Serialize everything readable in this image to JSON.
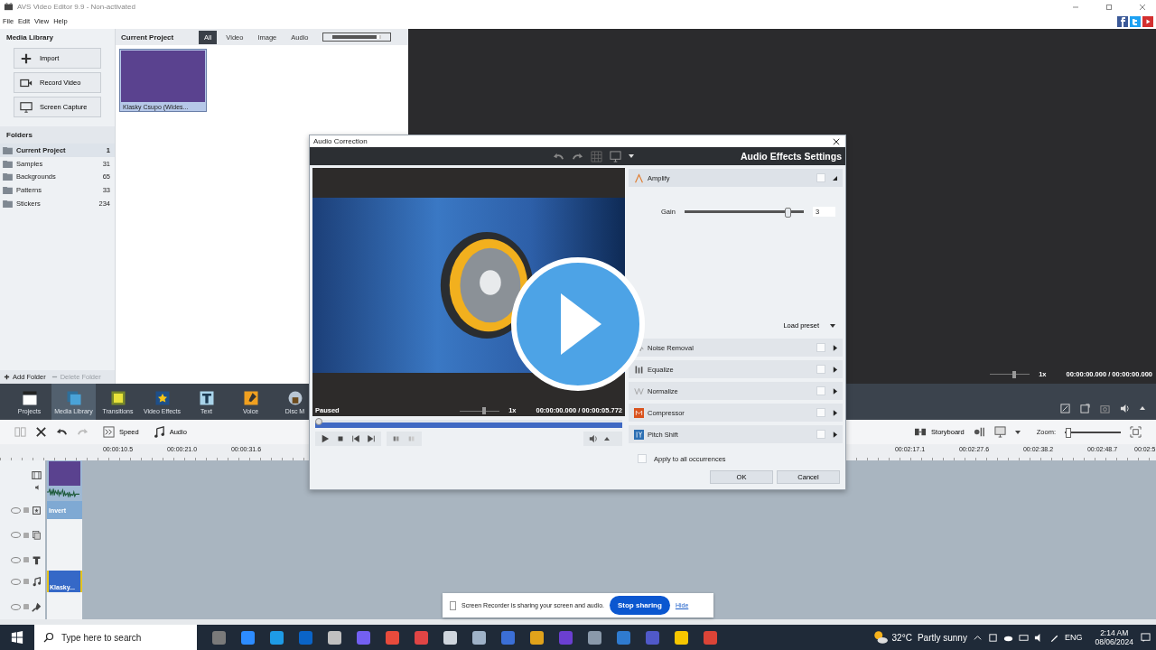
{
  "window": {
    "title": "AVS Video Editor 9.9 - Non-activated"
  },
  "menu": [
    "File",
    "Edit",
    "View",
    "Help"
  ],
  "media_library": {
    "title": "Media Library",
    "actions": [
      {
        "label": "Import",
        "kind": "import"
      },
      {
        "label": "Record Video",
        "kind": "record"
      },
      {
        "label": "Screen Capture",
        "kind": "capture"
      }
    ],
    "folders_title": "Folders",
    "folders": [
      {
        "name": "Current Project",
        "count": "1",
        "selected": true
      },
      {
        "name": "Samples",
        "count": "31",
        "selected": false
      },
      {
        "name": "Backgrounds",
        "count": "65",
        "selected": false
      },
      {
        "name": "Patterns",
        "count": "33",
        "selected": false
      },
      {
        "name": "Stickers",
        "count": "234",
        "selected": false
      }
    ],
    "add_folder": "Add Folder",
    "delete_folder": {
      "label": "Delete Folder",
      "disabled": true
    }
  },
  "project": {
    "title": "Current Project",
    "filters": [
      {
        "label": "All",
        "selected": true
      },
      {
        "label": "Video",
        "selected": false
      },
      {
        "label": "Image",
        "selected": false
      },
      {
        "label": "Audio",
        "selected": false
      }
    ],
    "size_slider": {
      "level": 0.95
    },
    "items": [
      {
        "name": "Klasky Csupo (Wides...",
        "selected": true
      }
    ]
  },
  "preview": {
    "speed_slider": {
      "level": 0.6
    },
    "speed": "1x",
    "time": "00:00:00.000 / 00:00:00.000"
  },
  "modes": [
    {
      "label": "Projects",
      "kind": "projects",
      "selected": false
    },
    {
      "label": "Media Library",
      "kind": "library",
      "selected": true
    },
    {
      "label": "Transitions",
      "kind": "transitions",
      "selected": false
    },
    {
      "label": "Video Effects",
      "kind": "effects",
      "selected": false
    },
    {
      "label": "Text",
      "kind": "text",
      "selected": false
    },
    {
      "label": "Voice",
      "kind": "voice",
      "selected": false
    },
    {
      "label": "Disc M",
      "kind": "disc",
      "selected": false
    }
  ],
  "timeline": {
    "tools": [
      {
        "label": "Speed",
        "kind": "speed"
      },
      {
        "label": "Audio",
        "kind": "audio"
      }
    ],
    "storyboard": "Storyboard",
    "zoom_label": "Zoom:",
    "zoom": {
      "level": 0.02
    },
    "ruler_left": [
      "00:00:10.5",
      "00:00:21.0",
      "00:00:31.6"
    ],
    "ruler_right": [
      "00:02:17.1",
      "00:02:27.6",
      "00:02:38.2",
      "00:02:48.7",
      "00:02:5"
    ],
    "effect_clip": "Invert",
    "audio_clip": "Klasky..."
  },
  "dialog": {
    "title": "Audio Correction",
    "heading": "Audio Effects Settings",
    "player": {
      "status": "Paused",
      "speed_slider": {
        "level": 0.6
      },
      "speed": "1x",
      "time": "00:00:00.000 / 00:00:05.772",
      "position": {
        "level": 0
      }
    },
    "effects": [
      {
        "name": "Amplify",
        "kind": "amplify",
        "expanded": true,
        "checked": false
      },
      {
        "name": "Noise Removal",
        "kind": "noise",
        "expanded": false,
        "checked": false
      },
      {
        "name": "Equalize",
        "kind": "equalize",
        "expanded": false,
        "checked": false
      },
      {
        "name": "Normalize",
        "kind": "normalize",
        "expanded": false,
        "checked": false
      },
      {
        "name": "Compressor",
        "kind": "compressor",
        "expanded": false,
        "checked": false
      },
      {
        "name": "Pitch Shift",
        "kind": "pitch",
        "expanded": false,
        "checked": false
      }
    ],
    "gain": {
      "label": "Gain",
      "level": 0.86,
      "value": "3"
    },
    "load_preset": "Load preset",
    "apply_all": {
      "label": "Apply to all occurrences",
      "checked": false
    },
    "buttons": [
      "OK",
      "Cancel"
    ]
  },
  "sharing": {
    "message": "Screen Recorder is sharing your screen and audio.",
    "stop": "Stop sharing",
    "hide": "Hide"
  },
  "taskbar": {
    "search_placeholder": "Type here to search",
    "temperature": "32°C",
    "weather": "Partly sunny",
    "language": "ENG",
    "time": "2:14 AM",
    "date": "08/06/2024"
  }
}
